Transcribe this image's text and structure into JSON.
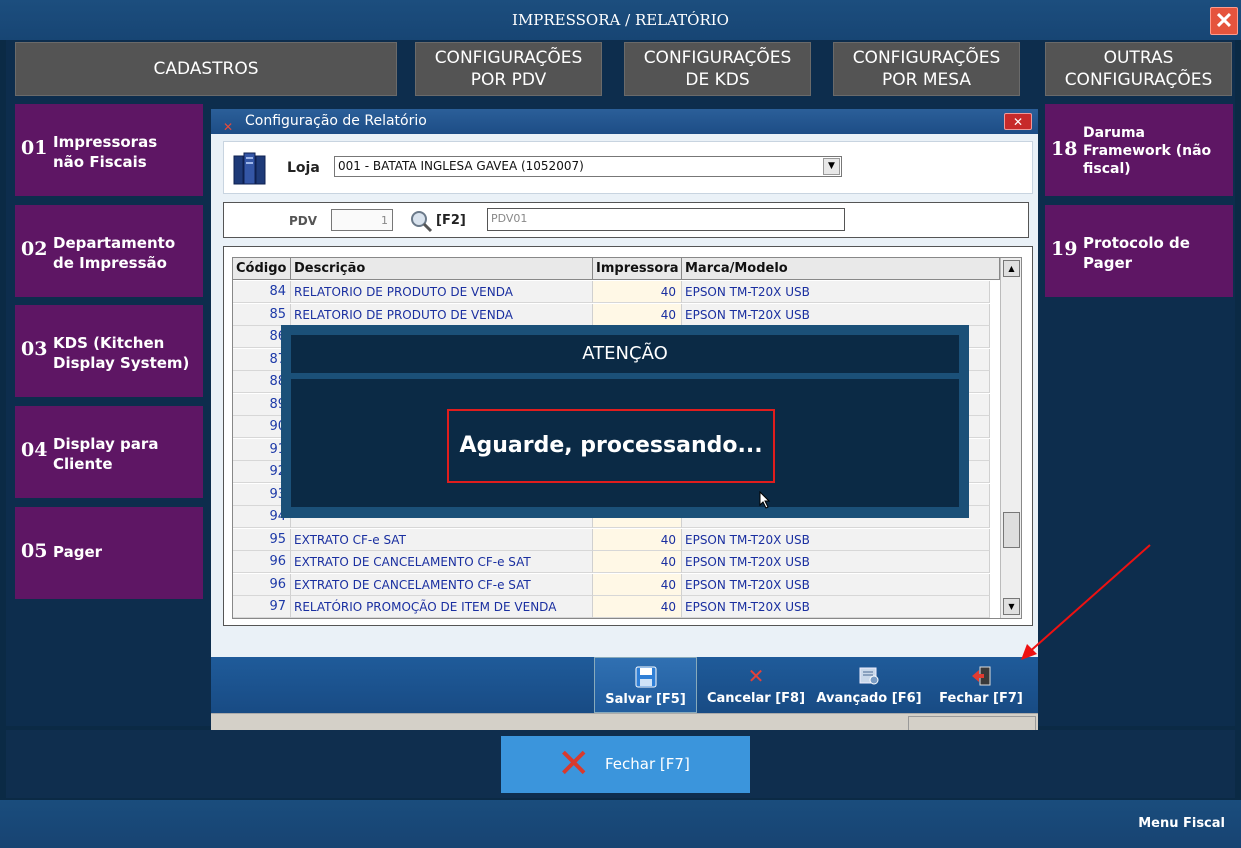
{
  "window": {
    "title": "IMPRESSORA / RELATÓRIO"
  },
  "tabs": {
    "cadastros": "CADASTROS",
    "pdv_l1": "CONFIGURAÇÕES",
    "pdv_l2": "POR PDV",
    "kds_l1": "CONFIGURAÇÕES",
    "kds_l2": "DE KDS",
    "mesa_l1": "CONFIGURAÇÕES",
    "mesa_l2": "POR MESA",
    "outras_l1": "OUTRAS",
    "outras_l2": "CONFIGURAÇÕES"
  },
  "menu": {
    "item01": {
      "num": "01",
      "line1": "Impressoras",
      "line2": "não Fiscais"
    },
    "item02": {
      "num": "02",
      "line1": "Departamento",
      "line2": "de Impressão"
    },
    "item03": {
      "num": "03",
      "line1": "KDS (Kitchen",
      "line2": "Display System)"
    },
    "item04": {
      "num": "04",
      "line1": "Display para",
      "line2": "Cliente"
    },
    "item05": {
      "num": "05",
      "line1": "Pager",
      "line2": ""
    },
    "item18": {
      "num": "18",
      "line1": "Daruma",
      "line2": "Framework (não",
      "line3": "fiscal)"
    },
    "item19": {
      "num": "19",
      "line1": "Protocolo de",
      "line2": "Pager"
    }
  },
  "dialog": {
    "title": "Configuração de Relatório",
    "loja_label": "Loja",
    "loja_value": "001 - BATATA INGLESA GAVEA (1052007)",
    "pdv_label": "PDV",
    "pdv_value": "1",
    "search_shortcut": "[F2]",
    "pdv_name": "PDV01"
  },
  "table": {
    "headers": {
      "codigo": "Código",
      "descricao": "Descrição",
      "impressora": "Impressora",
      "marca": "Marca/Modelo"
    },
    "rows": [
      {
        "codigo": "84",
        "descricao": "RELATORIO DE PRODUTO DE VENDA",
        "impressora": "40",
        "marca": "EPSON TM-T20X USB"
      },
      {
        "codigo": "85",
        "descricao": "RELATORIO DE PRODUTO DE VENDA",
        "impressora": "40",
        "marca": "EPSON TM-T20X USB"
      },
      {
        "codigo": "86",
        "descricao": "",
        "impressora": "",
        "marca": ""
      },
      {
        "codigo": "87",
        "descricao": "",
        "impressora": "",
        "marca": ""
      },
      {
        "codigo": "88",
        "descricao": "",
        "impressora": "",
        "marca": ""
      },
      {
        "codigo": "89",
        "descricao": "",
        "impressora": "",
        "marca": ""
      },
      {
        "codigo": "90",
        "descricao": "",
        "impressora": "",
        "marca": ""
      },
      {
        "codigo": "91",
        "descricao": "",
        "impressora": "",
        "marca": ""
      },
      {
        "codigo": "92",
        "descricao": "",
        "impressora": "",
        "marca": ""
      },
      {
        "codigo": "93",
        "descricao": "",
        "impressora": "",
        "marca": ""
      },
      {
        "codigo": "94",
        "descricao": "",
        "impressora": "",
        "marca": ""
      },
      {
        "codigo": "95",
        "descricao": "EXTRATO CF-e SAT",
        "impressora": "40",
        "marca": "EPSON TM-T20X USB"
      },
      {
        "codigo": "96",
        "descricao": "EXTRATO DE CANCELAMENTO CF-e SAT",
        "impressora": "40",
        "marca": "EPSON TM-T20X USB"
      },
      {
        "codigo": "96",
        "descricao": "EXTRATO DE CANCELAMENTO CF-e SAT",
        "impressora": "40",
        "marca": "EPSON TM-T20X USB"
      },
      {
        "codigo": "97",
        "descricao": "RELATÓRIO PROMOÇÃO DE ITEM DE VENDA",
        "impressora": "40",
        "marca": "EPSON TM-T20X USB"
      }
    ]
  },
  "toolbar": {
    "salvar": "Salvar [F5]",
    "cancelar": "Cancelar [F8]",
    "avancado": "Avançado [F6]",
    "fechar": "Fechar [F7]"
  },
  "attention": {
    "title": "ATENÇÃO",
    "message": "Aguarde, processando..."
  },
  "footer": {
    "fechar": "Fechar [F7]",
    "menu_fiscal": "Menu Fiscal"
  },
  "colors": {
    "tile": "#5e1664",
    "tab": "#545454",
    "background": "#0b2a45",
    "accent_red": "#e01d1d"
  }
}
